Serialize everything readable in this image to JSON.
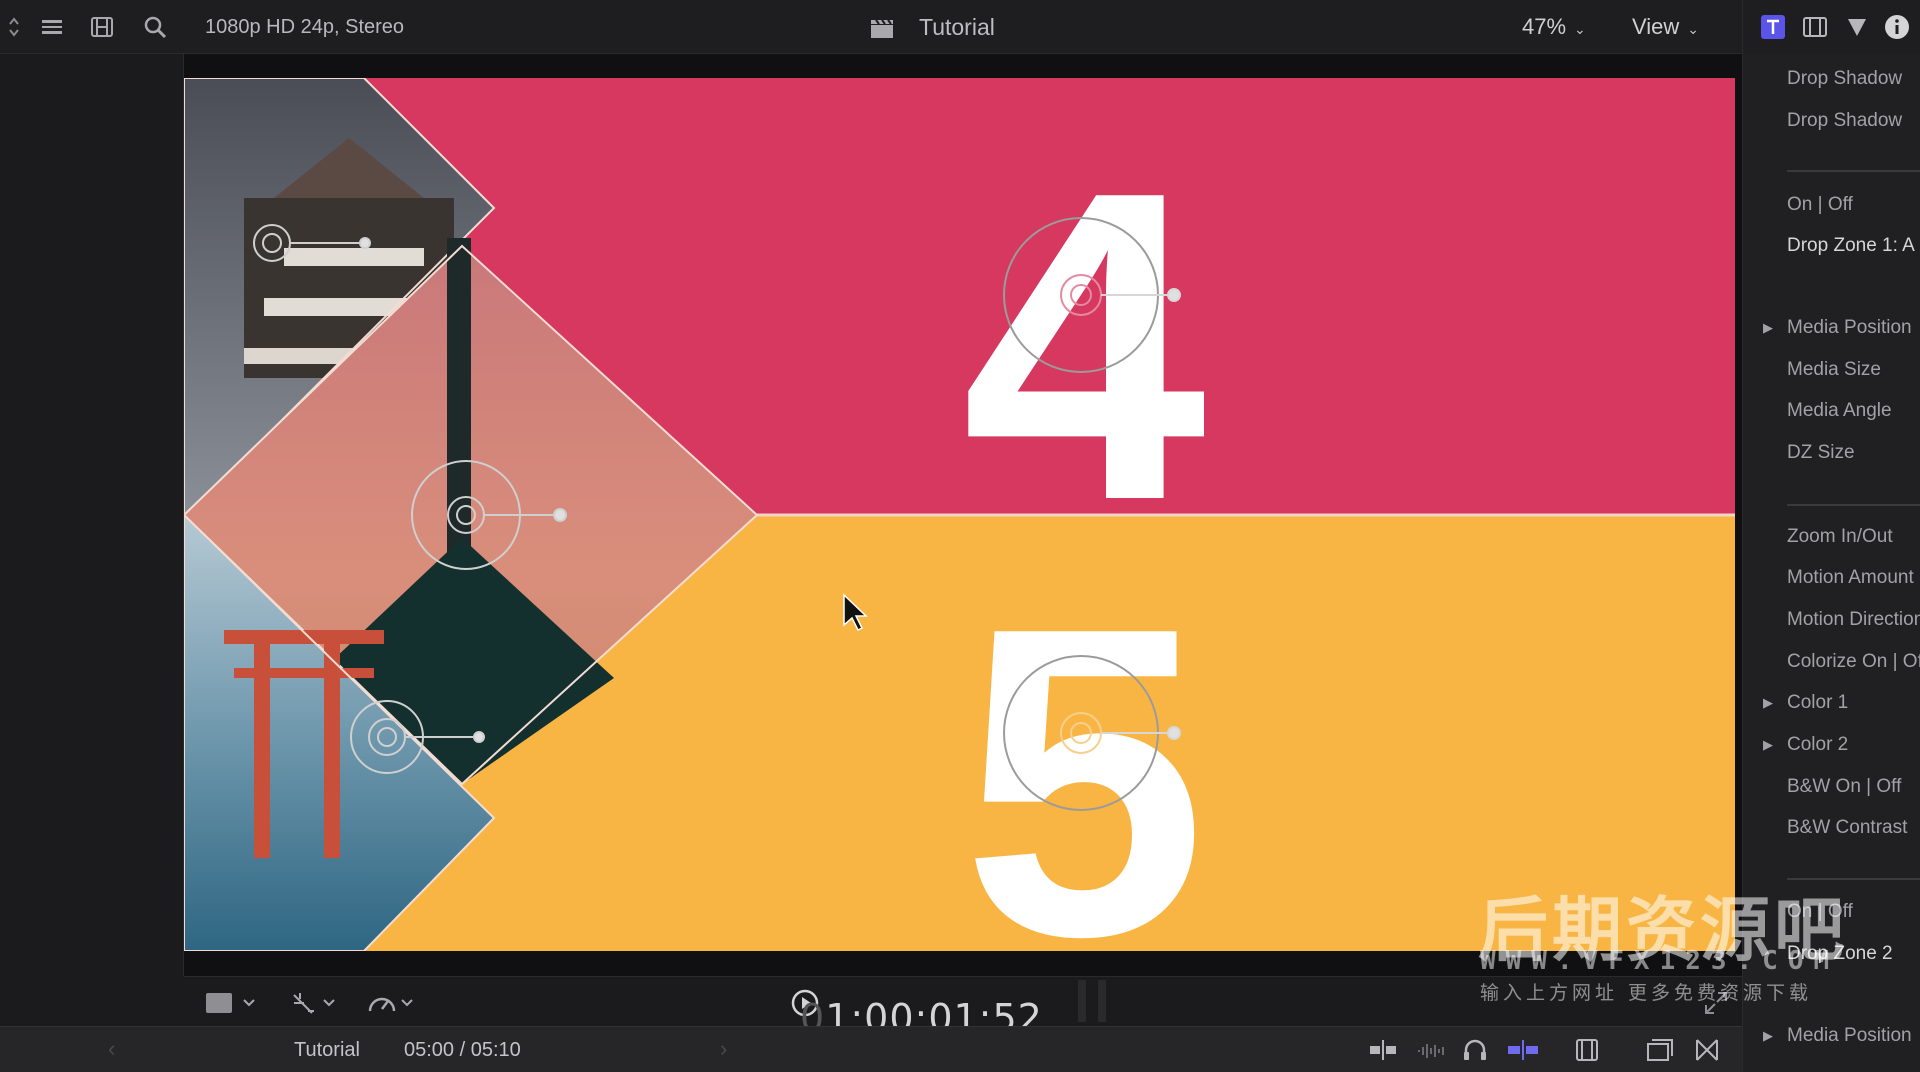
{
  "toolbar": {
    "format": "1080p HD 24p, Stereo",
    "project_title": "Tutorial",
    "zoom": "47%",
    "view_label": "View"
  },
  "canvas": {
    "digit_top": "4",
    "digit_bottom": "5",
    "colors": {
      "magenta": "#d6385f",
      "orange": "#f9b544",
      "sunset": "#cf7f6e",
      "sky": "#9fb5c4"
    }
  },
  "inspector": {
    "items": [
      {
        "label": "Drop Shadow"
      },
      {
        "label": "Drop Shadow"
      },
      {
        "label": "On | Off"
      },
      {
        "label": "Drop Zone 1: A"
      },
      {
        "label": "Media Position"
      },
      {
        "label": "Media Size"
      },
      {
        "label": "Media Angle"
      },
      {
        "label": "DZ Size"
      },
      {
        "label": "Zoom In/Out"
      },
      {
        "label": "Motion Amount"
      },
      {
        "label": "Motion Direction"
      },
      {
        "label": "Colorize On | Off"
      },
      {
        "label": "Color 1"
      },
      {
        "label": "Color 2"
      },
      {
        "label": "B&W On | Off"
      },
      {
        "label": "B&W Contrast"
      },
      {
        "label": "On | Off"
      },
      {
        "label": "Drop Zone 2"
      },
      {
        "label": "Media Position"
      }
    ]
  },
  "viewer": {
    "timecode": "1:00:01:52"
  },
  "status": {
    "project_name": "Tutorial",
    "duration": "05:00 / 05:10"
  },
  "watermark": {
    "title": "后期资源吧",
    "url": "WWW.VFX123.COM",
    "subtitle": "输入上方网址 更多免费资源下载"
  }
}
